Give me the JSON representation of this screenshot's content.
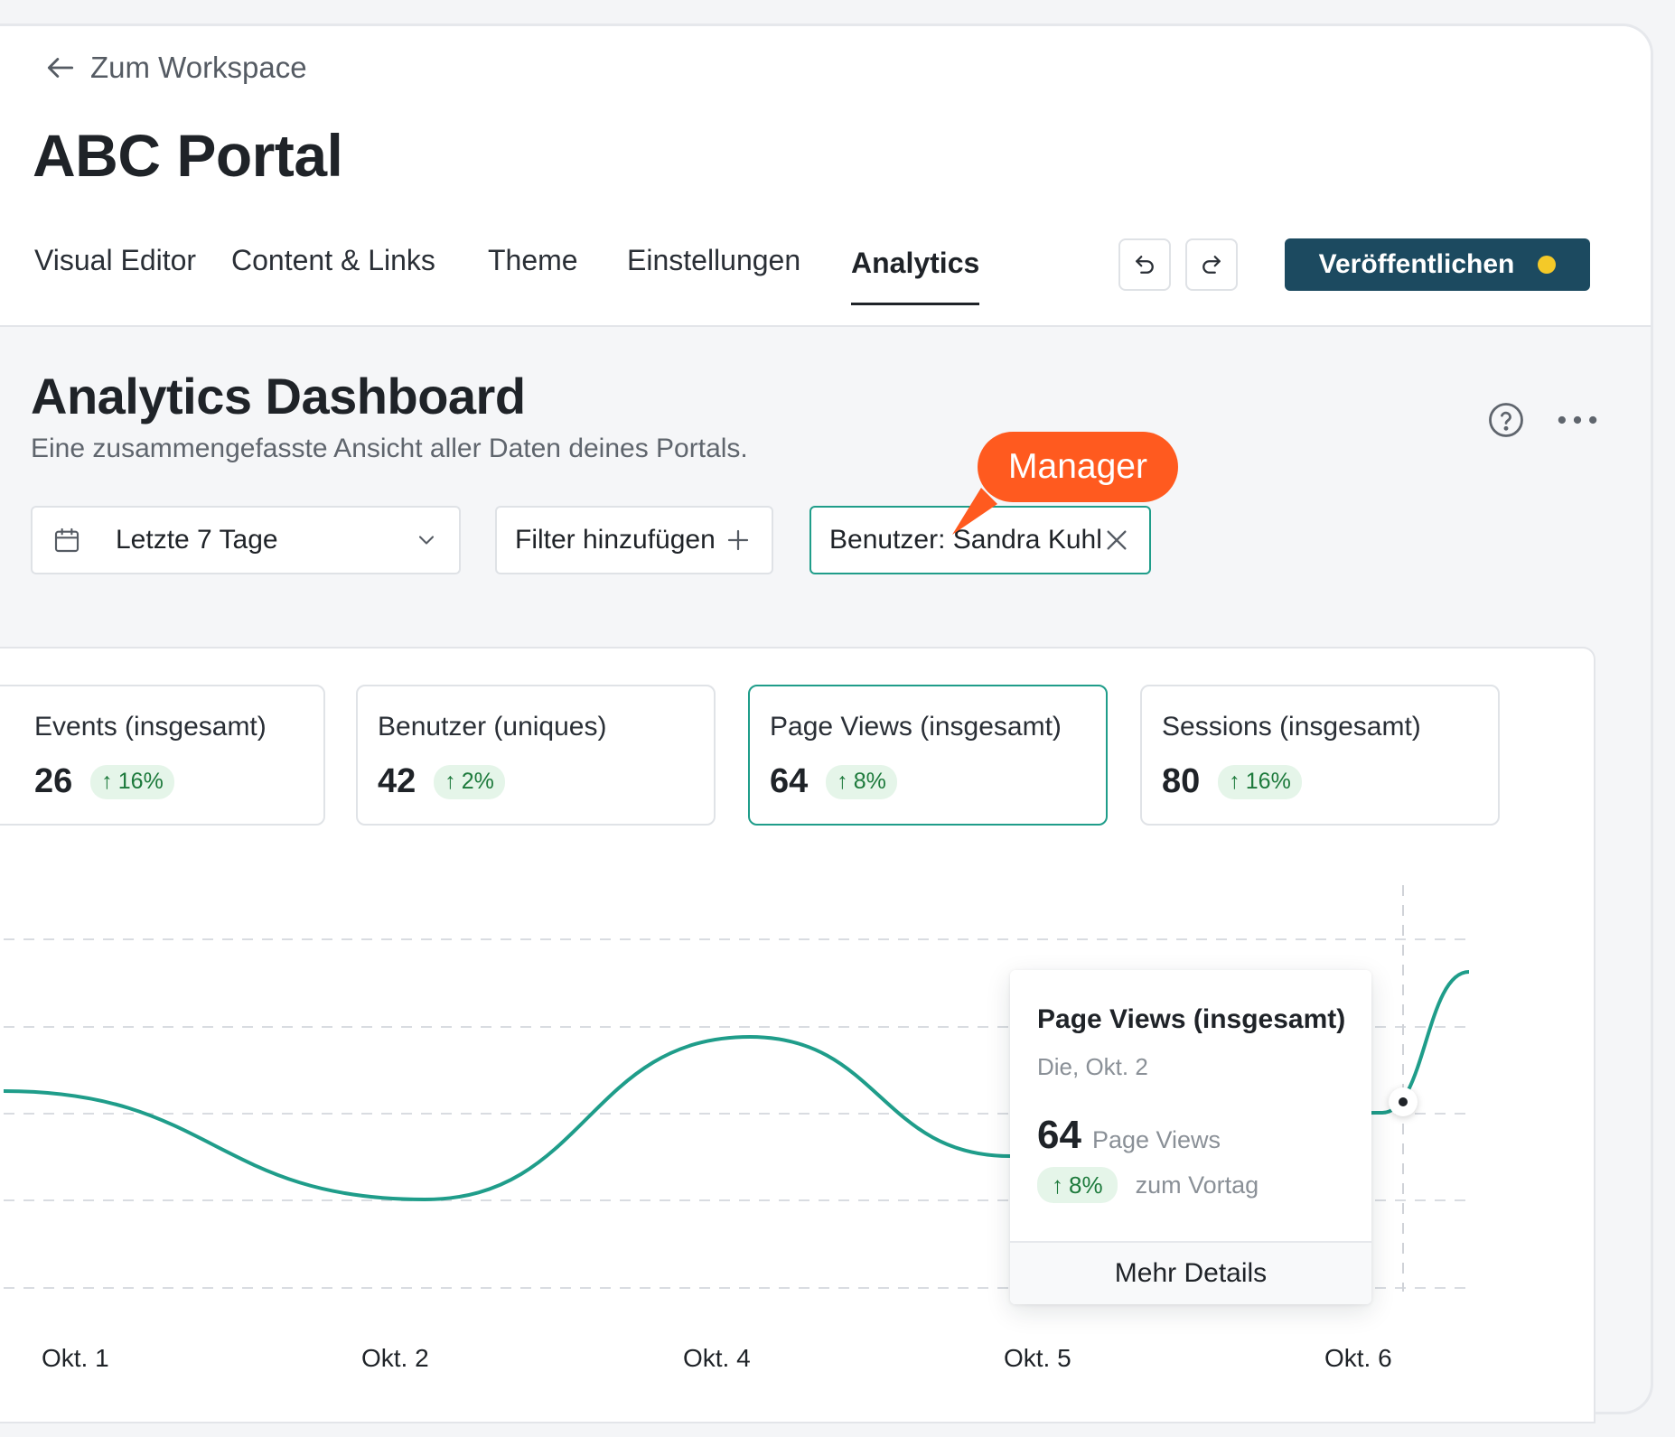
{
  "header": {
    "back_label": "Zum Workspace",
    "portal_title": "ABC Portal",
    "tabs": [
      {
        "label": "Visual Editor"
      },
      {
        "label": "Content & Links"
      },
      {
        "label": "Theme"
      },
      {
        "label": "Einstellungen"
      },
      {
        "label": "Analytics",
        "active": true
      }
    ],
    "publish_label": "Veröffentlichen",
    "icons": {
      "back": "arrow-left-icon",
      "undo": "undo-icon",
      "redo": "redo-icon",
      "publish_status": "status-dot"
    },
    "colors": {
      "publish_bg": "#1c4a60",
      "status_dot": "#f4c928"
    }
  },
  "dashboard": {
    "title": "Analytics Dashboard",
    "subtitle": "Eine zusammengefasste Ansicht aller Daten deines Portals.",
    "date_range": "Letzte 7 Tage",
    "add_filter": "Filter hinzufügen",
    "active_filter": "Benutzer: Sandra Kuhl",
    "annotation": "Manager",
    "icons": {
      "help": "help-circle-icon",
      "more": "more-horizontal-icon",
      "calendar": "calendar-icon",
      "chevron": "chevron-down-icon",
      "add": "plus-icon",
      "remove": "close-icon"
    },
    "colors": {
      "accent": "#1f9d8a",
      "annotation": "#ff5a1f",
      "positive": "#1d7a3c"
    }
  },
  "kpis": [
    {
      "label": "Events (insgesamt)",
      "value": "26",
      "change": "16%"
    },
    {
      "label": "Benutzer (uniques)",
      "value": "42",
      "change": "2%"
    },
    {
      "label": "Page Views (insgesamt)",
      "value": "64",
      "change": "8%",
      "selected": true
    },
    {
      "label": "Sessions (insgesamt)",
      "value": "80",
      "change": "16%"
    }
  ],
  "chart_data": {
    "type": "line",
    "series": [
      {
        "values": [
          46,
          36,
          51,
          40,
          44,
          57
        ]
      }
    ],
    "x_labels": [
      "Okt. 1",
      "Okt. 2",
      "Okt. 4",
      "Okt. 5",
      "Okt. 6"
    ],
    "grid": true,
    "line_color": "#1f9d8a"
  },
  "tooltip": {
    "title": "Page Views (insgesamt)",
    "date": "Die, Okt. 2",
    "value": "64",
    "unit": "Page Views",
    "change": "8%",
    "comparison": "zum Vortag",
    "details_label": "Mehr Details"
  }
}
